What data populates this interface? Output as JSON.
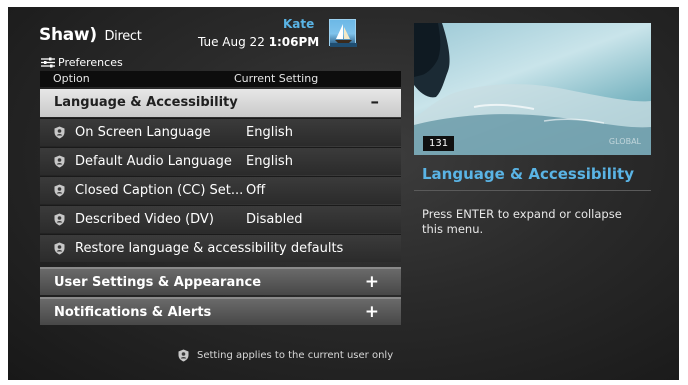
{
  "header": {
    "brand_name": "Shaw",
    "brand_sub": "Direct",
    "user_name": "Kate",
    "date": "Tue Aug 22",
    "time": "1:06PM",
    "avatar_icon": "sailboat-avatar-icon"
  },
  "breadcrumb": {
    "label": "Preferences",
    "icon": "sliders-icon"
  },
  "table": {
    "col_option": "Option",
    "col_setting": "Current Setting",
    "expanded_section": {
      "label": "Language & Accessibility",
      "toggle": "–"
    },
    "items": [
      {
        "label": "On Screen Language",
        "value": "English"
      },
      {
        "label": "Default Audio Language",
        "value": "English"
      },
      {
        "label": "Closed Caption (CC) Set...",
        "value": "Off"
      },
      {
        "label": "Described Video (DV)",
        "value": "Disabled"
      },
      {
        "label": "Restore language & accessibility defaults",
        "value": ""
      }
    ],
    "collapsed_sections": [
      {
        "label": "User Settings & Appearance",
        "toggle": "+"
      },
      {
        "label": "Notifications & Alerts",
        "toggle": "+"
      }
    ]
  },
  "footnote": "Setting applies to the current user only",
  "preview": {
    "channel": "131",
    "watermark": "GLOBAL"
  },
  "info": {
    "title": "Language & Accessibility",
    "description": "Press ENTER to expand or collapse this menu."
  },
  "colors": {
    "accent": "#5ab4e5",
    "background": "#2a2a2a",
    "selected_row": "#d8d8d8"
  }
}
